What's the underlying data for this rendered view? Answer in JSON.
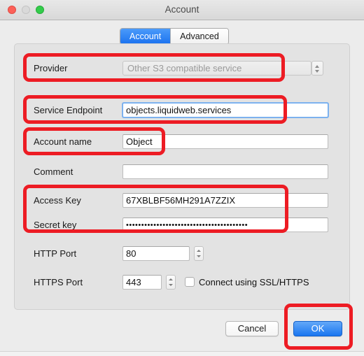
{
  "window": {
    "title": "Account",
    "traffic_lights": [
      {
        "name": "close",
        "color": "#fc6058"
      },
      {
        "name": "minimize",
        "color": "#d9d9d9"
      },
      {
        "name": "zoom",
        "color": "#33cc4b"
      }
    ]
  },
  "tabs": [
    {
      "label": "Account",
      "selected": true
    },
    {
      "label": "Advanced",
      "selected": false
    }
  ],
  "form": {
    "provider": {
      "label": "Provider",
      "value": "Other S3 compatible service",
      "disabled": true
    },
    "service_endpoint": {
      "label": "Service Endpoint",
      "value": "objects.liquidweb.services",
      "placeholder": "",
      "focused": true
    },
    "account_name": {
      "label": "Account name",
      "value": "Object",
      "placeholder": ""
    },
    "comment": {
      "label": "Comment",
      "value": "",
      "placeholder": ""
    },
    "access_key": {
      "label": "Access Key",
      "value": "67XBLBF56MH291A7ZZIX",
      "placeholder": ""
    },
    "secret_key": {
      "label": "Secret key",
      "value": "••••••••••••••••••••••••••••••••••••••••",
      "placeholder": ""
    },
    "http_port": {
      "label": "HTTP Port",
      "value": "80"
    },
    "https_port": {
      "label": "HTTPS Port",
      "value": "443"
    },
    "ssl_checkbox": {
      "label": "Connect using SSL/HTTPS",
      "checked": false
    }
  },
  "buttons": {
    "cancel": "Cancel",
    "ok": "OK"
  },
  "annotations": {
    "color": "#ed1c24",
    "regions": [
      "provider-row",
      "service-endpoint-row",
      "account-name-row",
      "access-and-secret-key-rows",
      "ok-button"
    ]
  }
}
